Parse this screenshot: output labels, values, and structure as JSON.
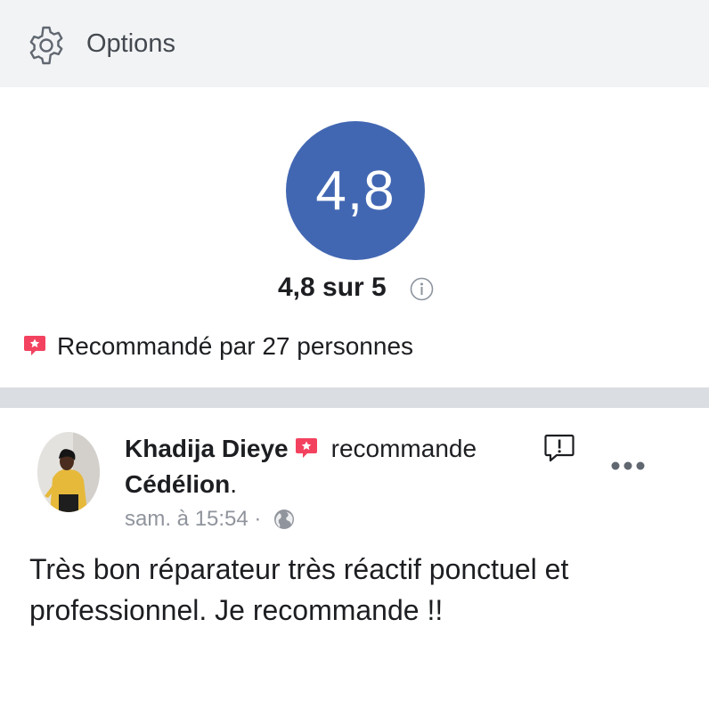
{
  "options_bar": {
    "label": "Options",
    "icon": "gear-icon"
  },
  "rating": {
    "score": "4,8",
    "summary": "4,8 sur 5",
    "recommendation": "Recommandé par 27 personnes",
    "accent": "#4267b2",
    "badge_color": "#f3425f"
  },
  "review": {
    "reviewer_name": "Khadija Dieye",
    "action": "recommande",
    "page_name": "Cédélion",
    "page_suffix": ".",
    "time": "sam. à 15:54",
    "separator": "·",
    "privacy_icon": "globe-icon",
    "text": "Très bon réparateur très réactif ponctuel et professionnel. Je recommande !!"
  }
}
